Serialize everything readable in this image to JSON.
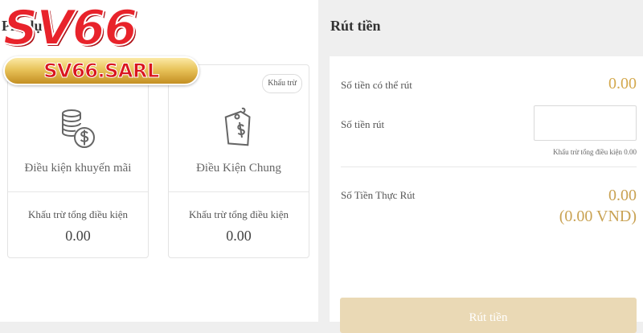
{
  "logo": {
    "brand": "SV66",
    "domain": "SV66.SARL"
  },
  "left": {
    "title": "Phụ lục",
    "cards": [
      {
        "icon": "coins-dollar-icon",
        "badge": "",
        "title": "Điều kiện khuyến mãi",
        "sub_label": "Khấu trừ tổng điều kiện",
        "value": "0.00"
      },
      {
        "icon": "price-tag-dollar-icon",
        "badge": "Khấu trừ",
        "title": "Điều Kiện Chung",
        "sub_label": "Khấu trừ tổng điều kiện",
        "value": "0.00"
      }
    ]
  },
  "withdraw": {
    "title": "Rút tiền",
    "available_label": "Số tiền có thể rút",
    "available_value": "0.00",
    "amount_label": "Số tiền rút",
    "amount_value": "",
    "hint": "Khấu trừ tổng điều kiện 0.00",
    "actual_label": "Số Tiền Thực Rút",
    "actual_value": "0.00",
    "actual_vnd": "(0.00 VND)",
    "button_label": "Rút tiền"
  },
  "colors": {
    "accent_gold": "#d4a94e",
    "button_bg": "#ead9b5",
    "brand_red": "#e8232b"
  }
}
